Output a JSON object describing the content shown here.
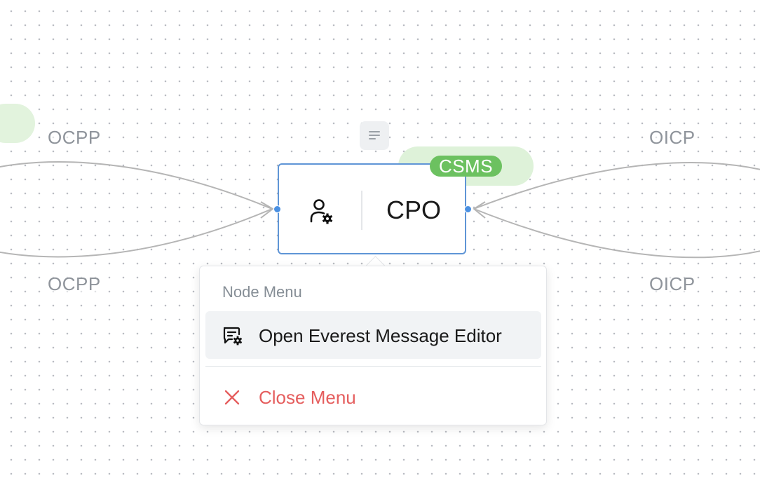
{
  "edges": {
    "left_top_label": "OCPP",
    "left_bottom_label": "OCPP",
    "right_top_label": "OICP",
    "right_bottom_label": "OICP"
  },
  "node": {
    "label": "CPO",
    "badge": "CSMS",
    "icon": "user-gear-icon",
    "accent_color": "#5f95d6",
    "badge_color": "#6cc160"
  },
  "node_menu": {
    "heading": "Node Menu",
    "items": [
      {
        "label": "Open Everest Message Editor",
        "icon": "message-gear-icon"
      },
      {
        "label": "Close Menu",
        "icon": "close-icon",
        "color": "#e55e5e"
      }
    ]
  }
}
